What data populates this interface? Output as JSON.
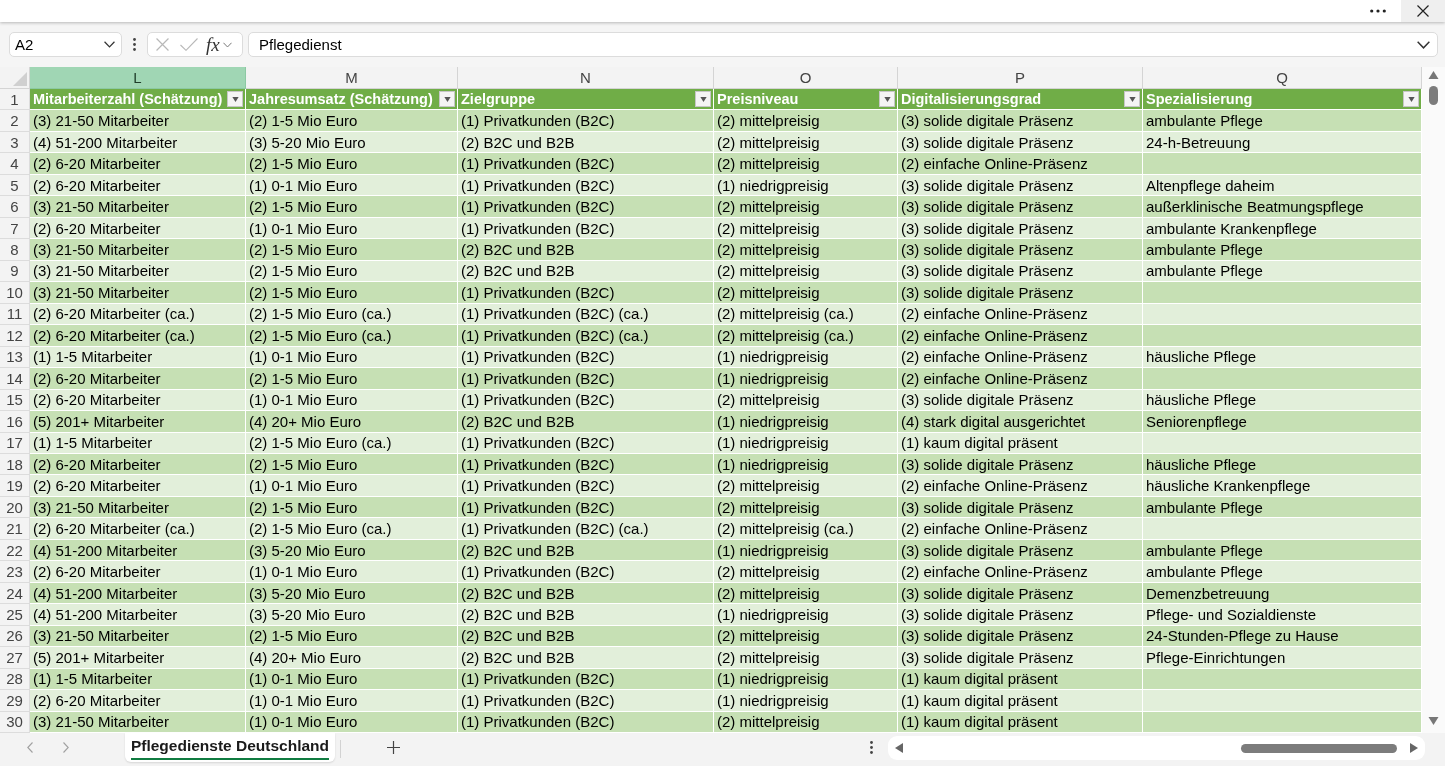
{
  "formula_bar": {
    "name_box": "A2",
    "function_button": "fx",
    "formula": "Pflegedienst"
  },
  "sheet": {
    "columns": [
      {
        "letter": "L",
        "selected": true
      },
      {
        "letter": "M",
        "selected": false
      },
      {
        "letter": "N",
        "selected": false
      },
      {
        "letter": "O",
        "selected": false
      },
      {
        "letter": "P",
        "selected": false
      },
      {
        "letter": "Q",
        "selected": false
      }
    ],
    "header_row": {
      "number": "1",
      "cells": [
        "Mitarbeiterzahl (Schätzung)",
        "Jahresumsatz (Schätzung)",
        "Zielgruppe",
        "Preisniveau",
        "Digitalisierungsgrad",
        "Spezialisierung"
      ]
    },
    "rows": [
      {
        "number": "2",
        "cells": [
          "(3) 21-50 Mitarbeiter",
          "(2) 1-5 Mio Euro",
          "(1) Privatkunden (B2C)",
          "(2) mittelpreisig",
          "(3) solide digitale Präsenz",
          "ambulante Pflege"
        ]
      },
      {
        "number": "3",
        "cells": [
          "(4) 51-200 Mitarbeiter",
          "(3) 5-20 Mio Euro",
          "(2) B2C und B2B",
          "(2) mittelpreisig",
          "(3) solide digitale Präsenz",
          "24-h-Betreuung"
        ]
      },
      {
        "number": "4",
        "cells": [
          "(2) 6-20 Mitarbeiter",
          "(2) 1-5 Mio Euro",
          "(1) Privatkunden (B2C)",
          "(2) mittelpreisig",
          "(2) einfache Online-Präsenz"
        ]
      },
      {
        "number": "5",
        "cells": [
          "(2) 6-20 Mitarbeiter",
          "(1) 0-1 Mio Euro",
          "(1) Privatkunden (B2C)",
          "(1) niedrigpreisig",
          "(3) solide digitale Präsenz",
          "Altenpflege daheim"
        ]
      },
      {
        "number": "6",
        "cells": [
          "(3) 21-50 Mitarbeiter",
          "(2) 1-5 Mio Euro",
          "(1) Privatkunden (B2C)",
          "(2) mittelpreisig",
          "(3) solide digitale Präsenz",
          "außerklinische Beatmungspflege"
        ]
      },
      {
        "number": "7",
        "cells": [
          "(2) 6-20 Mitarbeiter",
          "(1) 0-1 Mio Euro",
          "(1) Privatkunden (B2C)",
          "(2) mittelpreisig",
          "(3) solide digitale Präsenz",
          "ambulante Krankenpflege"
        ]
      },
      {
        "number": "8",
        "cells": [
          "(3) 21-50 Mitarbeiter",
          "(2) 1-5 Mio Euro",
          "(2) B2C und B2B",
          "(2) mittelpreisig",
          "(3) solide digitale Präsenz",
          "ambulante Pflege"
        ]
      },
      {
        "number": "9",
        "cells": [
          "(3) 21-50 Mitarbeiter",
          "(2) 1-5 Mio Euro",
          "(2) B2C und B2B",
          "(2) mittelpreisig",
          "(3) solide digitale Präsenz",
          "ambulante Pflege"
        ]
      },
      {
        "number": "10",
        "cells": [
          "(3) 21-50 Mitarbeiter",
          "(2) 1-5 Mio Euro",
          "(1) Privatkunden (B2C)",
          "(2) mittelpreisig",
          "(3) solide digitale Präsenz"
        ]
      },
      {
        "number": "11",
        "cells": [
          "(2) 6-20 Mitarbeiter (ca.)",
          "(2) 1-5 Mio Euro (ca.)",
          "(1) Privatkunden (B2C) (ca.)",
          "(2) mittelpreisig (ca.)",
          "(2) einfache Online-Präsenz"
        ]
      },
      {
        "number": "12",
        "cells": [
          "(2) 6-20 Mitarbeiter (ca.)",
          "(2) 1-5 Mio Euro (ca.)",
          "(1) Privatkunden (B2C) (ca.)",
          "(2) mittelpreisig (ca.)",
          "(2) einfache Online-Präsenz"
        ]
      },
      {
        "number": "13",
        "cells": [
          "(1) 1-5 Mitarbeiter",
          "(1) 0-1 Mio Euro",
          "(1) Privatkunden (B2C)",
          "(1) niedrigpreisig",
          "(2) einfache Online-Präsenz",
          "häusliche Pflege"
        ]
      },
      {
        "number": "14",
        "cells": [
          "(2) 6-20 Mitarbeiter",
          "(2) 1-5 Mio Euro",
          "(1) Privatkunden (B2C)",
          "(1) niedrigpreisig",
          "(2) einfache Online-Präsenz"
        ]
      },
      {
        "number": "15",
        "cells": [
          "(2) 6-20 Mitarbeiter",
          "(1) 0-1 Mio Euro",
          "(1) Privatkunden (B2C)",
          "(2) mittelpreisig",
          "(3) solide digitale Präsenz",
          "häusliche Pflege"
        ]
      },
      {
        "number": "16",
        "cells": [
          "(5) 201+ Mitarbeiter",
          "(4) 20+ Mio Euro",
          "(2) B2C und B2B",
          "(1) niedrigpreisig",
          "(4) stark digital ausgerichtet",
          "Seniorenpflege"
        ]
      },
      {
        "number": "17",
        "cells": [
          "(1) 1-5 Mitarbeiter",
          "(2) 1-5 Mio Euro (ca.)",
          "(1) Privatkunden (B2C)",
          "(1) niedrigpreisig",
          "(1) kaum digital präsent"
        ]
      },
      {
        "number": "18",
        "cells": [
          "(2) 6-20 Mitarbeiter",
          "(2) 1-5 Mio Euro",
          "(1) Privatkunden (B2C)",
          "(1) niedrigpreisig",
          "(3) solide digitale Präsenz",
          "häusliche Pflege"
        ]
      },
      {
        "number": "19",
        "cells": [
          "(2) 6-20 Mitarbeiter",
          "(1) 0-1 Mio Euro",
          "(1) Privatkunden (B2C)",
          "(2) mittelpreisig",
          "(2) einfache Online-Präsenz",
          "häusliche Krankenpflege"
        ]
      },
      {
        "number": "20",
        "cells": [
          "(3) 21-50 Mitarbeiter",
          "(2) 1-5 Mio Euro",
          "(1) Privatkunden (B2C)",
          "(2) mittelpreisig",
          "(3) solide digitale Präsenz",
          "ambulante Pflege"
        ]
      },
      {
        "number": "21",
        "cells": [
          "(2) 6-20 Mitarbeiter (ca.)",
          "(2) 1-5 Mio Euro (ca.)",
          "(1) Privatkunden (B2C) (ca.)",
          "(2) mittelpreisig (ca.)",
          "(2) einfache Online-Präsenz"
        ]
      },
      {
        "number": "22",
        "cells": [
          "(4) 51-200 Mitarbeiter",
          "(3) 5-20 Mio Euro",
          "(2) B2C und B2B",
          "(1) niedrigpreisig",
          "(3) solide digitale Präsenz",
          "ambulante Pflege"
        ]
      },
      {
        "number": "23",
        "cells": [
          "(2) 6-20 Mitarbeiter",
          "(1) 0-1 Mio Euro",
          "(1) Privatkunden (B2C)",
          "(2) mittelpreisig",
          "(2) einfache Online-Präsenz",
          "ambulante Pflege"
        ]
      },
      {
        "number": "24",
        "cells": [
          "(4) 51-200 Mitarbeiter",
          "(3) 5-20 Mio Euro",
          "(2) B2C und B2B",
          "(2) mittelpreisig",
          "(3) solide digitale Präsenz",
          "Demenzbetreuung"
        ]
      },
      {
        "number": "25",
        "cells": [
          "(4) 51-200 Mitarbeiter",
          "(3) 5-20 Mio Euro",
          "(2) B2C und B2B",
          "(1) niedrigpreisig",
          "(3) solide digitale Präsenz",
          "Pflege- und Sozialdienste"
        ]
      },
      {
        "number": "26",
        "cells": [
          "(3) 21-50 Mitarbeiter",
          "(2) 1-5 Mio Euro",
          "(2) B2C und B2B",
          "(2) mittelpreisig",
          "(3) solide digitale Präsenz",
          "24-Stunden-Pflege zu Hause"
        ]
      },
      {
        "number": "27",
        "cells": [
          "(5) 201+ Mitarbeiter",
          "(4) 20+ Mio Euro",
          "(2) B2C und B2B",
          "(2) mittelpreisig",
          "(3) solide digitale Präsenz",
          "Pflege-Einrichtungen"
        ]
      },
      {
        "number": "28",
        "cells": [
          "(1) 1-5 Mitarbeiter",
          "(1) 0-1 Mio Euro",
          "(1) Privatkunden (B2C)",
          "(1) niedrigpreisig",
          "(1) kaum digital präsent"
        ]
      },
      {
        "number": "29",
        "cells": [
          "(2) 6-20 Mitarbeiter",
          "(1) 0-1 Mio Euro",
          "(1) Privatkunden (B2C)",
          "(1) niedrigpreisig",
          "(1) kaum digital präsent"
        ]
      },
      {
        "number": "30",
        "cells": [
          "(3) 21-50 Mitarbeiter",
          "(1) 0-1 Mio Euro",
          "(1) Privatkunden (B2C)",
          "(2) mittelpreisig",
          "(1) kaum digital präsent"
        ]
      }
    ]
  },
  "sheet_tabs": [
    {
      "label": "Pflegedienste Deutschland",
      "selected": true
    }
  ]
}
